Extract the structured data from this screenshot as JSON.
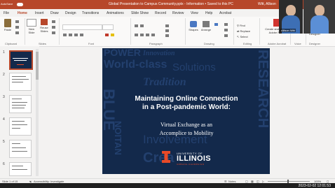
{
  "titlebar": {
    "autosave": "AutoSave",
    "title": "Global Presentation to Campus Community.pptx - Information • Saved to this PC",
    "user": "Witt, Allison"
  },
  "tabs": [
    "File",
    "Home",
    "Insert",
    "Draw",
    "Design",
    "Transitions",
    "Animations",
    "Slide Show",
    "Record",
    "Review",
    "View",
    "Help",
    "Acrobat"
  ],
  "ribbon": {
    "paste": "Paste",
    "new_slide": "New Slide",
    "reuse_slides": "Reuse Slides",
    "groups": {
      "clipboard": "Clipboard",
      "slides": "Slides",
      "font": "Font",
      "paragraph": "Paragraph",
      "drawing": "Drawing",
      "editing": "Editing",
      "adobe_acrobat": "Adobe Acrobat",
      "voice": "Voice",
      "designer": "Designer"
    },
    "shapes": "Shapes",
    "arrange": "Arrange",
    "find": "Find",
    "replace": "Replace",
    "select": "Select",
    "create_share": "Create and Share Adobe PDF",
    "dictate": "Dictate",
    "designer_btn": "Designer"
  },
  "video": {
    "participant_name": "Allison Witt"
  },
  "thumbnails": [
    "1",
    "2",
    "3",
    "4",
    "5",
    "6"
  ],
  "slide": {
    "bg_words": [
      "POWER",
      "Innovation",
      "World-class",
      "Solutions",
      "BLUE",
      "Tradition",
      "RESEARCH",
      "NOITAN",
      "Involvement",
      "Crea"
    ],
    "title_line1": "Maintaining Online Connection",
    "title_line2": "in a Post-pandemic World:",
    "subtitle_line1": "Virtual Exchange as an",
    "subtitle_line2": "Accomplice to Mobility",
    "logo_university": "UNIVERSITY OF",
    "logo_illinois": "ILLINOIS",
    "logo_campus": "URBANA-CHAMPAIGN"
  },
  "status": {
    "slide_counter": "Slide 1 of 15",
    "accessibility": "Accessibility: Investigate",
    "notes": "Notes",
    "zoom": "100%"
  },
  "taskbar": {
    "datetime": "2023-02-02 12:01:53"
  },
  "colors": {
    "accent": "#b7472a",
    "slide_bg": "#13294b",
    "illinois_orange": "#e84a27"
  }
}
